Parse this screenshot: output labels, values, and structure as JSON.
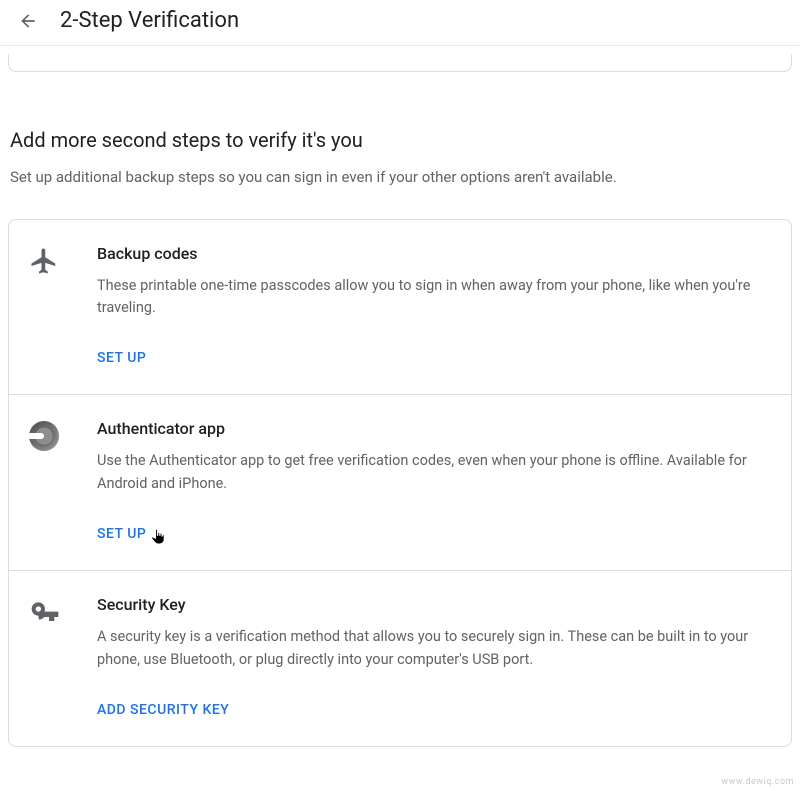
{
  "header": {
    "title": "2-Step Verification"
  },
  "section": {
    "heading": "Add more second steps to verify it's you",
    "subheading": "Set up additional backup steps so you can sign in even if your other options aren't available."
  },
  "options": {
    "backup_codes": {
      "title": "Backup codes",
      "desc": "These printable one-time passcodes allow you to sign in when away from your phone, like when you're traveling.",
      "action": "SET UP"
    },
    "authenticator": {
      "title": "Authenticator app",
      "desc": "Use the Authenticator app to get free verification codes, even when your phone is offline. Available for Android and iPhone.",
      "action": "SET UP"
    },
    "security_key": {
      "title": "Security Key",
      "desc": "A security key is a verification method that allows you to securely sign in. These can be built in to your phone, use Bluetooth, or plug directly into your computer's USB port.",
      "action": "ADD SECURITY KEY"
    }
  },
  "watermark": "www.dewiq.com"
}
